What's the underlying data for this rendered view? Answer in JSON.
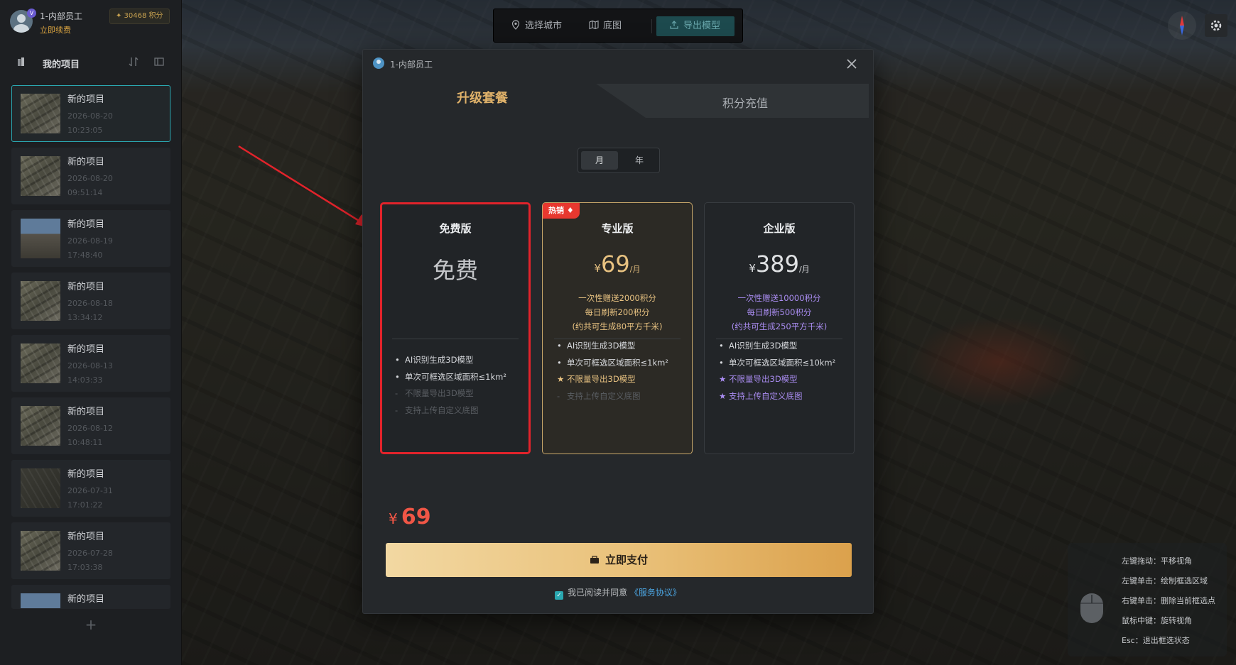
{
  "sidebar": {
    "user_name": "1-内部员工",
    "avatar_badge": "V",
    "renew_label": "立即续费",
    "points": "✦ 30468 积分",
    "projects_title": "我的项目",
    "add_label": "+",
    "projects": [
      {
        "name": "新的项目",
        "date": "2026-08-20",
        "time": "10:23:05"
      },
      {
        "name": "新的项目",
        "date": "2026-08-20",
        "time": "09:51:14"
      },
      {
        "name": "新的项目",
        "date": "2026-08-19",
        "time": "17:48:40"
      },
      {
        "name": "新的项目",
        "date": "2026-08-18",
        "time": "13:34:12"
      },
      {
        "name": "新的项目",
        "date": "2026-08-13",
        "time": "14:03:33"
      },
      {
        "name": "新的项目",
        "date": "2026-08-12",
        "time": "10:48:11"
      },
      {
        "name": "新的项目",
        "date": "2026-07-31",
        "time": "17:01:22"
      },
      {
        "name": "新的项目",
        "date": "2026-07-28",
        "time": "17:03:38"
      },
      {
        "name": "新的项目"
      }
    ]
  },
  "toolbar": {
    "select_city": "选择城市",
    "basemap": "底图",
    "export_model": "导出模型"
  },
  "hints": {
    "left_drag": "左键拖动：平移视角",
    "left_click": "左键单击：绘制框选区域",
    "right_click": "右键单击：删除当前框选点",
    "middle": "鼠标中键：旋转视角",
    "esc": "Esc：退出框选状态"
  },
  "modal": {
    "user": "1-内部员工",
    "tab_upgrade": "升级套餐",
    "tab_recharge": "积分充值",
    "period_month": "月",
    "period_year": "年",
    "plans": {
      "free": {
        "name": "免费版",
        "price_text": "免费",
        "features": [
          "AI识别生成3D模型",
          "单次可框选区域面积≤1km²",
          "不限量导出3D模型",
          "支持上传自定义底图"
        ]
      },
      "pro": {
        "badge": "热销",
        "name": "专业版",
        "currency": "¥",
        "price": "69",
        "unit": "/月",
        "desc": [
          "一次性赠送2000积分",
          "每日刷新200积分",
          "(约共可生成80平方千米)"
        ],
        "features": [
          "AI识别生成3D模型",
          "单次可框选区域面积≤1km²",
          "不限量导出3D模型",
          "支持上传自定义底图"
        ]
      },
      "ent": {
        "name": "企业版",
        "currency": "¥",
        "price": "389",
        "unit": "/月",
        "desc": [
          "一次性赠送10000积分",
          "每日刷新500积分",
          "(约共可生成250平方千米)"
        ],
        "features": [
          "AI识别生成3D模型",
          "单次可框选区域面积≤10km²",
          "不限量导出3D模型",
          "支持上传自定义底图"
        ]
      }
    },
    "total_currency": "¥",
    "total_amount": "69",
    "pay_label": "立即支付",
    "agree_text": "我已阅读并同意",
    "agree_link": "《服务协议》"
  },
  "colors": {
    "accent_gold": "#e8c281",
    "accent_purple": "#a98cf0",
    "accent_teal": "#2aa7b0",
    "highlight_red": "#e2232b",
    "price_red": "#f05646"
  }
}
